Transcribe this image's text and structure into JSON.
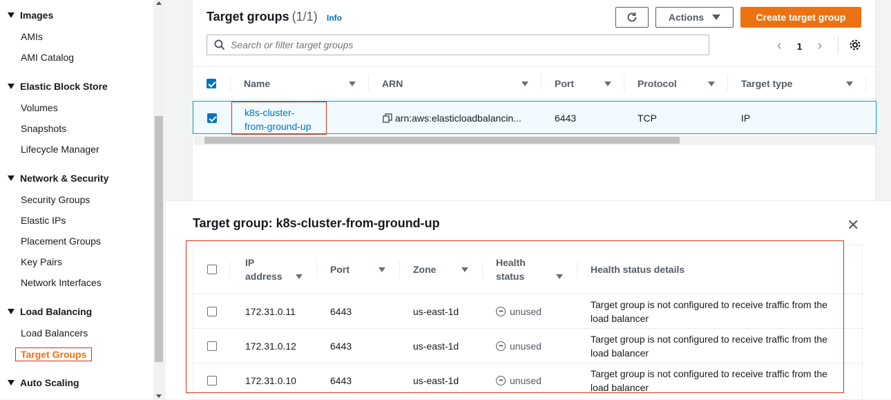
{
  "sidebar": {
    "sections": [
      {
        "label": "Images",
        "items": [
          "AMIs",
          "AMI Catalog"
        ]
      },
      {
        "label": "Elastic Block Store",
        "items": [
          "Volumes",
          "Snapshots",
          "Lifecycle Manager"
        ]
      },
      {
        "label": "Network & Security",
        "items": [
          "Security Groups",
          "Elastic IPs",
          "Placement Groups",
          "Key Pairs",
          "Network Interfaces"
        ]
      },
      {
        "label": "Load Balancing",
        "items": [
          "Load Balancers",
          "Target Groups"
        ]
      },
      {
        "label": "Auto Scaling",
        "items": []
      }
    ],
    "active_item": "Target Groups"
  },
  "target_groups": {
    "title": "Target groups",
    "count": "(1/1)",
    "info_label": "Info",
    "actions_label": "Actions",
    "create_label": "Create target group",
    "search_placeholder": "Search or filter target groups",
    "page": "1",
    "columns": [
      "Name",
      "ARN",
      "Port",
      "Protocol",
      "Target type"
    ],
    "rows": [
      {
        "name": "k8s-cluster-from-ground-up",
        "arn": "arn:aws:elasticloadbalancin...",
        "port": "6443",
        "protocol": "TCP",
        "target_type": "IP"
      }
    ]
  },
  "detail": {
    "title": "Target group: k8s-cluster-from-ground-up",
    "columns": [
      "IP address",
      "Port",
      "Zone",
      "Health status",
      "Health status details"
    ],
    "rows": [
      {
        "ip": "172.31.0.11",
        "port": "6443",
        "zone": "us-east-1d",
        "status": "unused",
        "details": "Target group is not configured to receive traffic from the load balancer"
      },
      {
        "ip": "172.31.0.12",
        "port": "6443",
        "zone": "us-east-1d",
        "status": "unused",
        "details": "Target group is not configured to receive traffic from the load balancer"
      },
      {
        "ip": "172.31.0.10",
        "port": "6443",
        "zone": "us-east-1d",
        "status": "unused",
        "details": "Target group is not configured to receive traffic from the load balancer"
      }
    ]
  },
  "colors": {
    "accent": "#ec7211",
    "link": "#0073bb",
    "highlight_border": "#d13212"
  }
}
